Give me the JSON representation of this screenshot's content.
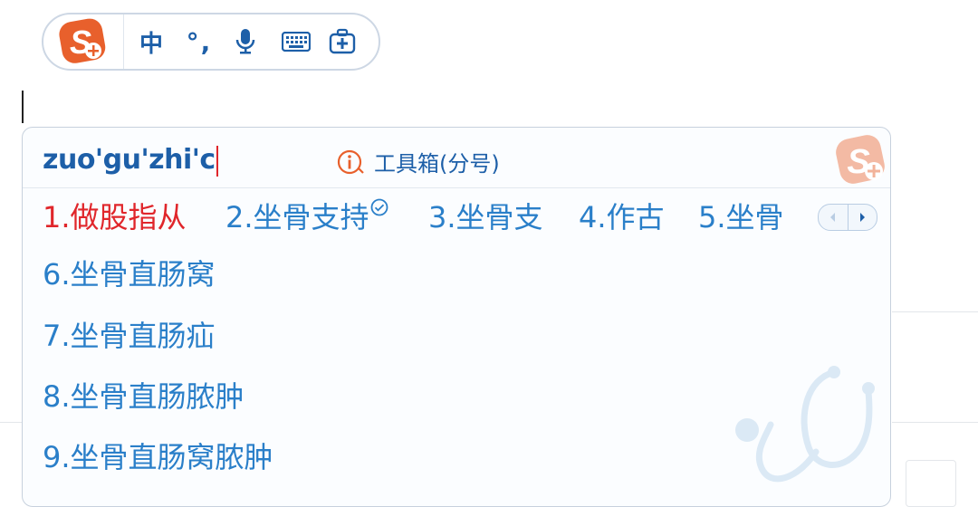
{
  "status_bar": {
    "mode_label": "中",
    "punct_label": "°,",
    "icons": [
      "sogou-logo-icon",
      "microphone-icon",
      "keyboard-icon",
      "toolbox-icon"
    ]
  },
  "candidate_window": {
    "composition": "zuo'gu'zhi'c",
    "toolbox_hint": "工具箱(分号)",
    "candidates": [
      {
        "label": "1.做股指从"
      },
      {
        "label": "2.坐骨支持",
        "badge": "check-circle-icon"
      },
      {
        "label": "3.坐骨支"
      },
      {
        "label": "4.作古"
      },
      {
        "label": "5.坐骨"
      },
      {
        "label": "6.坐骨直肠窝"
      },
      {
        "label": "7.坐骨直肠疝"
      },
      {
        "label": "8.坐骨直肠脓肿"
      },
      {
        "label": "9.坐骨直肠窝脓肿"
      }
    ],
    "pager": [
      "prev-page-icon",
      "next-page-icon"
    ],
    "decoration": "stethoscope-icon"
  },
  "colors": {
    "accent": "#1d5fa8",
    "candidate": "#2a7fc9",
    "first_candidate": "#e0262b",
    "logo": "#e8602c"
  }
}
